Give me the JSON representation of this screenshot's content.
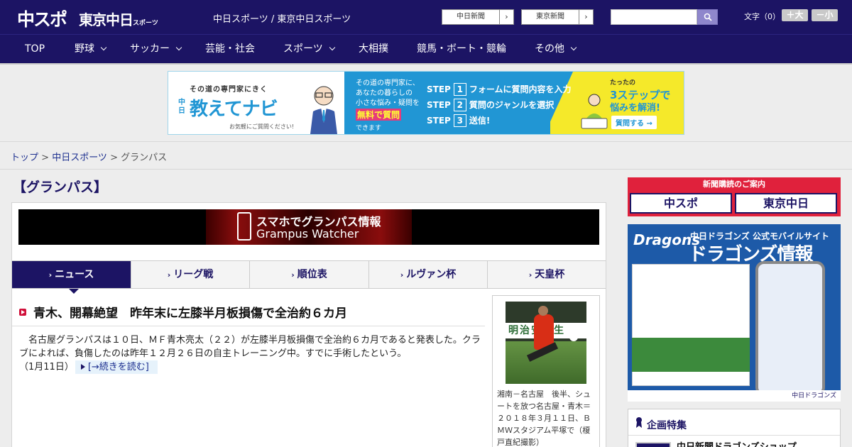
{
  "header": {
    "logo_chuspo": "中スポ",
    "logo_tokyo": "東京中日",
    "logo_tokyo_small": "スポーツ",
    "site_name": "中日スポーツ / 東京中日スポーツ",
    "links": [
      {
        "label": "中日新聞",
        "arrow": "›"
      },
      {
        "label": "東京新聞",
        "arrow": "›"
      }
    ],
    "search_placeholder": "",
    "fontsize_label": "文字（0）",
    "font_larger": "＋大",
    "font_smaller": "－小"
  },
  "nav": {
    "items": [
      {
        "label": "TOP"
      },
      {
        "label": "野球"
      },
      {
        "label": "サッカー"
      },
      {
        "label": "芸能・社会"
      },
      {
        "label": "スポーツ"
      },
      {
        "label": "大相撲"
      },
      {
        "label": "競馬・ボート・競輪"
      },
      {
        "label": "その他"
      }
    ]
  },
  "banner": {
    "sub": "その道の専門家にきく",
    "chu": "中日",
    "title": "教えてナビ",
    "ask": "お気軽にご質問ください!",
    "text2_l1": "その道の専門家に、",
    "text2_l2": "あなたの暮らしの",
    "text2_l3": "小さな悩み・疑問を",
    "free": "無料で質問",
    "dekimasu": "できます",
    "steps": [
      {
        "word": "STEP",
        "num": "1",
        "text": "フォームに質問内容を入力"
      },
      {
        "word": "STEP",
        "num": "2",
        "text": "質問のジャンルを選択"
      },
      {
        "word": "STEP",
        "num": "3",
        "text": "送信!"
      }
    ],
    "y1": "たったの",
    "y2": "3ステップで",
    "y3": "悩みを解消!",
    "question_btn": "質問する →"
  },
  "breadcrumb": {
    "top": "トップ",
    "sep": " > ",
    "chunichi": "中日スポーツ",
    "current": "グランパス"
  },
  "page_title": "【グランパス】",
  "gw_banner": {
    "line1": "スマホでグランパス情報",
    "line2": "Grampus Watcher"
  },
  "tabs": [
    {
      "label": "ニュース",
      "mark": "›"
    },
    {
      "label": "リーグ戦",
      "mark": "›"
    },
    {
      "label": "順位表",
      "mark": "›"
    },
    {
      "label": "ルヴァン杯",
      "mark": "›"
    },
    {
      "label": "天皇杯",
      "mark": "›"
    }
  ],
  "article": {
    "title": "青木、開幕絶望　昨年末に左膝半月板損傷で全治約６カ月",
    "body": "　名古屋グランパスは１０日、ＭＦ青木亮太（２２）が左膝半月板損傷で全治約６カ月であると発表した。クラブによれば、負傷したのは昨年１２月２６日の自主トレーニング中。すでに手術したという。",
    "date": "（1月11日）",
    "read_more": "[→続きを読む]",
    "photo_board": "明治安田生",
    "caption": "湘南－名古屋　後半、シュートを放つ名古屋・青木＝２０１８年３月１１日、ＢＭＷスタジアム平塚で（榎戸直紀撮影）"
  },
  "sidebar": {
    "subscribe_head": "新聞購読のご案内",
    "sub_chuspo": "中スポ",
    "sub_tokyo": "東京中日",
    "dragons_logo": "Dragons",
    "dragons_t1": "中日ドラゴンズ 公式モバイルサイト",
    "dragons_t2": "ドラゴンズ情報",
    "dragons_foot": "中日ドラゴンズ",
    "feature_title": "企画特集",
    "feature_item": "中日新聞ドラゴンズショップ"
  }
}
